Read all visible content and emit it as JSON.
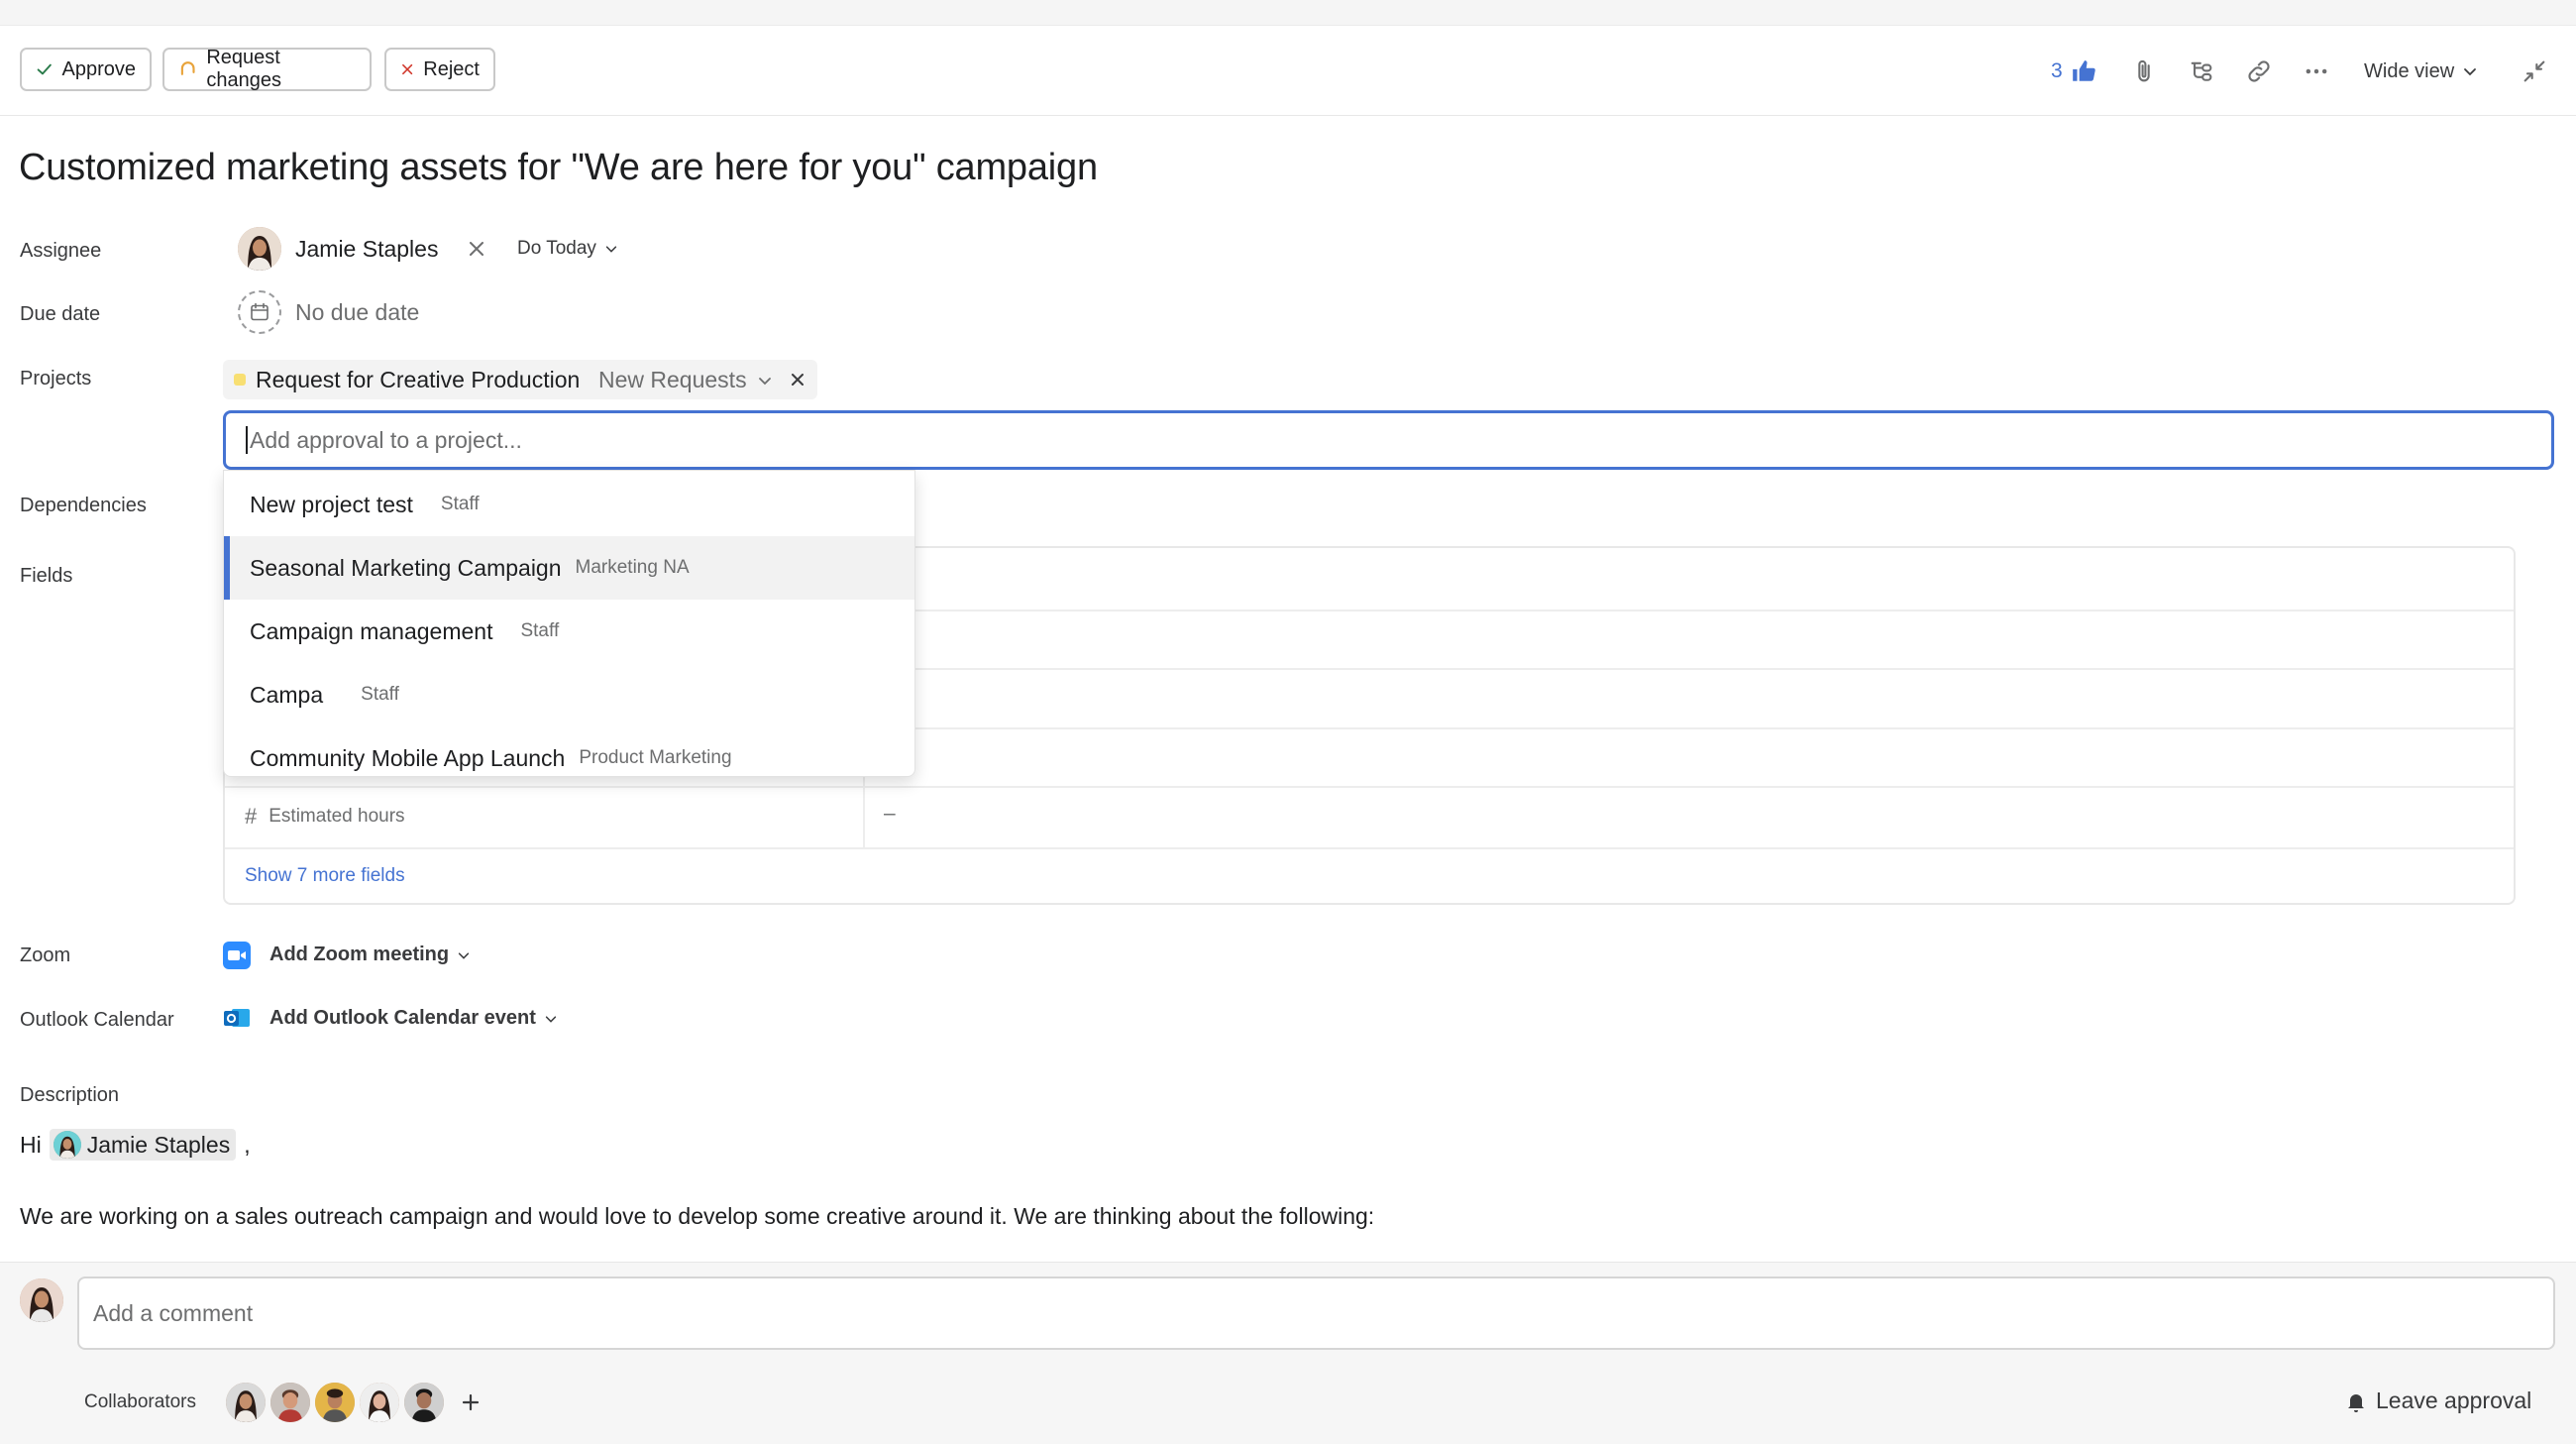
{
  "toolbar": {
    "approve_label": "Approve",
    "request_changes_label": "Request changes",
    "reject_label": "Reject",
    "likes_count": "3",
    "wide_view_label": "Wide view"
  },
  "task": {
    "title": "Customized marketing assets for \"We are here for you\" campaign"
  },
  "assignee": {
    "label": "Assignee",
    "name": "Jamie Staples",
    "section": "Do Today"
  },
  "due_date": {
    "label": "Due date",
    "value": "No due date"
  },
  "projects": {
    "label": "Projects",
    "project_name": "Request for Creative Production",
    "section": "New Requests",
    "input_placeholder": "Add approval to a project..."
  },
  "dropdown": {
    "items": [
      {
        "name": "New project test",
        "team": "Staff"
      },
      {
        "name": "Seasonal Marketing Campaign",
        "team": "Marketing NA"
      },
      {
        "name": "Campaign management",
        "team": "Staff"
      },
      {
        "name": "Campa",
        "team": "Staff"
      },
      {
        "name": "Community Mobile App Launch",
        "team": "Product Marketing"
      }
    ]
  },
  "dependencies": {
    "label": "Dependencies"
  },
  "fields": {
    "label": "Fields",
    "estimated_hours_label": "Estimated hours",
    "estimated_hours_value": "–",
    "show_more": "Show 7 more fields"
  },
  "zoom": {
    "label": "Zoom",
    "action": "Add Zoom meeting"
  },
  "outlook": {
    "label": "Outlook Calendar",
    "action": "Add Outlook Calendar event"
  },
  "description": {
    "label": "Description",
    "greeting": "Hi",
    "mention": "Jamie Staples",
    "comma": ",",
    "body": "We are working on a sales outreach campaign and would love to develop some creative around it. We are thinking about the following:"
  },
  "comment": {
    "placeholder": "Add a comment",
    "collaborators_label": "Collaborators",
    "leave_label": "Leave approval"
  },
  "colors": {
    "accent_blue": "#4573d2",
    "project_dot": "#f8df72",
    "zoom_blue": "#2d8cff",
    "outlook_blue": "#0f6cbd"
  }
}
